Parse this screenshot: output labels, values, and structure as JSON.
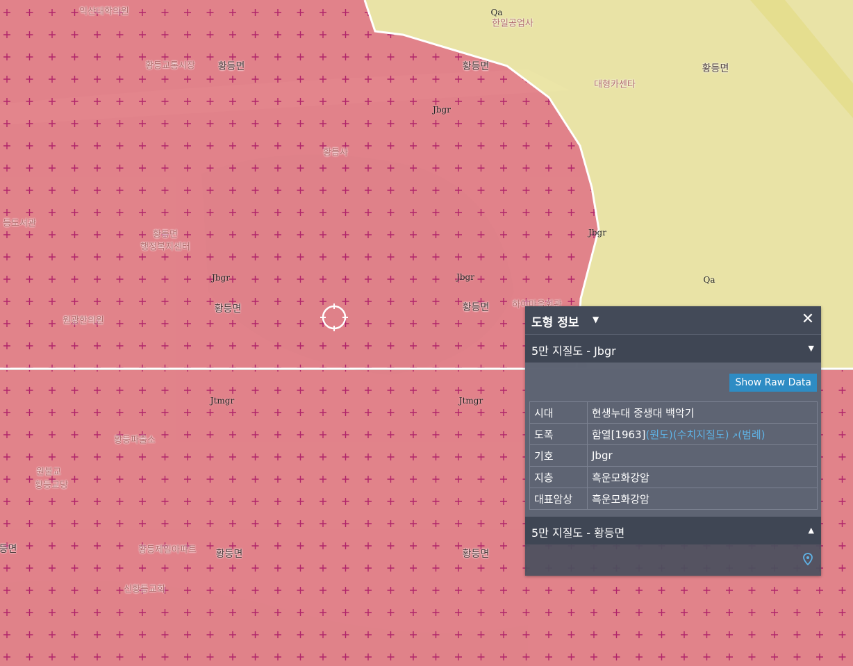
{
  "map": {
    "overlay_color": "#e8808a",
    "qa_color": "#efe9a8",
    "labels": [
      {
        "text": "익산대학의원",
        "kind": "poi"
      },
      {
        "text": "황등교통시장",
        "kind": "poi"
      },
      {
        "text": "황등면",
        "kind": "place"
      },
      {
        "text": "황등면",
        "kind": "place"
      },
      {
        "text": "한일공업사",
        "kind": "poi"
      },
      {
        "text": "황등면",
        "kind": "place"
      },
      {
        "text": "대형카센타",
        "kind": "poi"
      },
      {
        "text": "황등사",
        "kind": "poi"
      },
      {
        "text": "등도서관",
        "kind": "poi"
      },
      {
        "text": "황등면",
        "kind": "poi"
      },
      {
        "text": "행정복지센터",
        "kind": "poi"
      },
      {
        "text": "황등면",
        "kind": "place"
      },
      {
        "text": "황등면",
        "kind": "place"
      },
      {
        "text": "원광한의원",
        "kind": "poi"
      },
      {
        "text": "하이마을회관",
        "kind": "poi"
      },
      {
        "text": "황등파출소",
        "kind": "poi"
      },
      {
        "text": "원불교",
        "kind": "poi"
      },
      {
        "text": "황등교당",
        "kind": "poi"
      },
      {
        "text": "황등제일아파트",
        "kind": "poi"
      },
      {
        "text": "황등면",
        "kind": "place"
      },
      {
        "text": "황등면",
        "kind": "place"
      },
      {
        "text": "신황등교회",
        "kind": "poi"
      },
      {
        "text": "황등면",
        "kind": "place"
      }
    ],
    "geo_codes": [
      "Qa",
      "Jbgr",
      "Jbgr",
      "Jbgr",
      "Jbgr",
      "Qa",
      "Jtmgr",
      "Jtmgr"
    ]
  },
  "panel": {
    "title": "도형 정보",
    "section1": {
      "label": "5만 지질도 - Jbgr",
      "raw_button": "Show Raw Data",
      "rows": [
        {
          "key": "시대",
          "value": "현생누대 중생대 백악기"
        },
        {
          "key": "도폭",
          "value": "함열[1963]",
          "links": [
            "(원도)",
            "(수치지질도)",
            "(범례)"
          ]
        },
        {
          "key": "기호",
          "value": "Jbgr"
        },
        {
          "key": "지층",
          "value": "흑운모화강암"
        },
        {
          "key": "대표암상",
          "value": "흑운모화강암"
        }
      ]
    },
    "section2": {
      "label": "5만 지질도 - 황등면"
    }
  }
}
